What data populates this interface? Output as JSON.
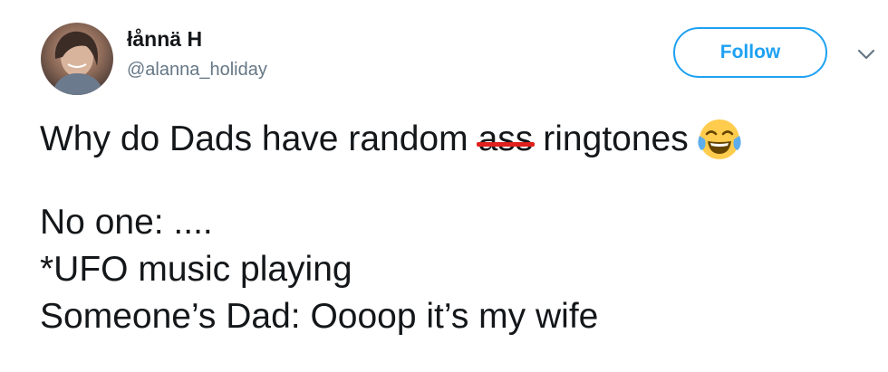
{
  "user": {
    "display_name": "łånnä H",
    "handle": "@alanna_holiday",
    "avatar_icon": "profile-photo"
  },
  "actions": {
    "follow_label": "Follow",
    "menu_icon": "chevron-down-icon"
  },
  "tweet": {
    "line1_before": "Why do Dads have random",
    "line1_struck": "ass",
    "line1_after": "ringtones",
    "line1_emoji": "face-with-tears-of-joy",
    "line2": "No one: ....",
    "line3": "*UFO music playing",
    "line4": "Someone’s Dad: Oooop it’s my wife"
  },
  "colors": {
    "accent": "#1da1f2",
    "text": "#14171a",
    "secondary": "#657786",
    "strike": "#e0201c"
  }
}
